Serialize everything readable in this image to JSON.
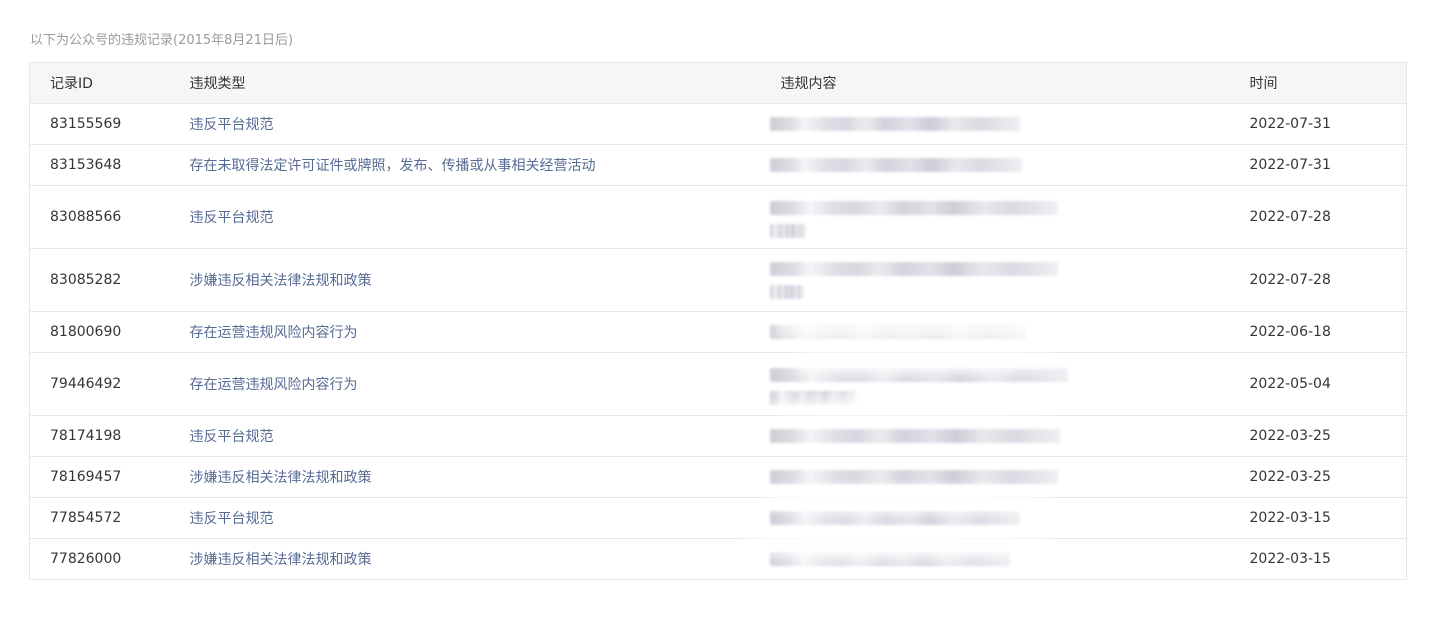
{
  "caption": "以下为公众号的违规记录(2015年8月21日后)",
  "table": {
    "headers": {
      "id": "记录ID",
      "type": "违规类型",
      "content": "违规内容",
      "time": "时间"
    },
    "rows": [
      {
        "id": "83155569",
        "type": "违反平台规范",
        "time": "2022-07-31"
      },
      {
        "id": "83153648",
        "type": "存在未取得法定许可证件或牌照，发布、传播或从事相关经营活动",
        "time": "2022-07-31"
      },
      {
        "id": "83088566",
        "type": "违反平台规范",
        "time": "2022-07-28"
      },
      {
        "id": "83085282",
        "type": "涉嫌违反相关法律法规和政策",
        "time": "2022-07-28"
      },
      {
        "id": "81800690",
        "type": "存在运营违规风险内容行为",
        "time": "2022-06-18"
      },
      {
        "id": "79446492",
        "type": "存在运营违规风险内容行为",
        "time": "2022-05-04"
      },
      {
        "id": "78174198",
        "type": "违反平台规范",
        "time": "2022-03-25"
      },
      {
        "id": "78169457",
        "type": "涉嫌违反相关法律法规和政策",
        "time": "2022-03-25"
      },
      {
        "id": "77854572",
        "type": "违反平台规范",
        "time": "2022-03-15"
      },
      {
        "id": "77826000",
        "type": "涉嫌违反相关法律法规和政策",
        "time": "2022-03-15"
      }
    ]
  },
  "colors": {
    "link": "#576b95",
    "text": "#353535",
    "muted": "#9a9a9a",
    "header_bg": "#f5f6f7",
    "border": "#e6e7eb"
  }
}
